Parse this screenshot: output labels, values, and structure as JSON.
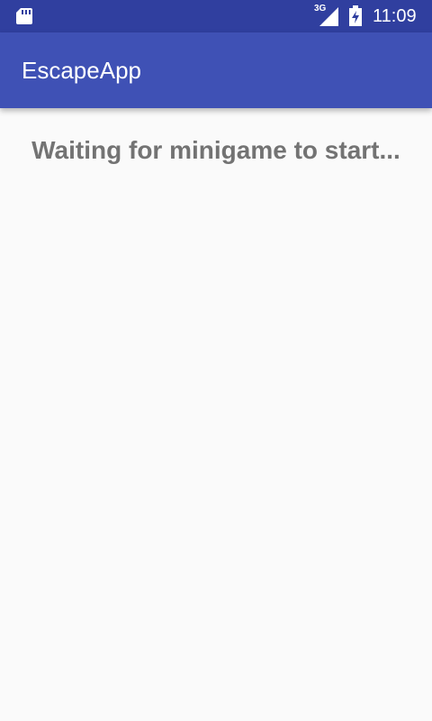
{
  "status_bar": {
    "sd_icon": "sd-card-icon",
    "network_label": "3G",
    "network_icon": "signal-icon",
    "battery_icon": "battery-charging-icon",
    "time": "11:09"
  },
  "app_bar": {
    "title": "EscapeApp"
  },
  "main": {
    "message": "Waiting for minigame to start..."
  },
  "colors": {
    "status_bar": "#303f9f",
    "app_bar": "#3f51b5",
    "background": "#fafafa",
    "message_text": "#737373"
  }
}
